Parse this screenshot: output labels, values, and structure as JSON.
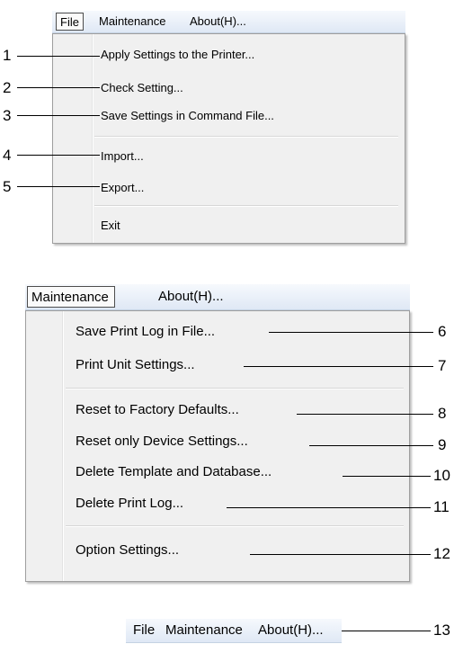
{
  "menu_a": {
    "bar": [
      "File",
      "Maintenance",
      "About(H)..."
    ],
    "items": [
      "Apply Settings to the Printer...",
      "Check Setting...",
      "Save Settings in Command File...",
      "Import...",
      "Export...",
      "Exit"
    ],
    "callouts": [
      "1",
      "2",
      "3",
      "4",
      "5"
    ]
  },
  "menu_b": {
    "bar": [
      "Maintenance",
      "About(H)..."
    ],
    "items": [
      "Save Print Log in File...",
      "Print Unit Settings...",
      "Reset to Factory Defaults...",
      "Reset only Device Settings...",
      "Delete Template and Database...",
      "Delete Print Log...",
      "Option Settings..."
    ],
    "callouts": [
      "6",
      "7",
      "8",
      "9",
      "10",
      "11",
      "12"
    ]
  },
  "menu_c": {
    "bar": [
      "File",
      "Maintenance",
      "About(H)..."
    ],
    "callout": "13"
  }
}
